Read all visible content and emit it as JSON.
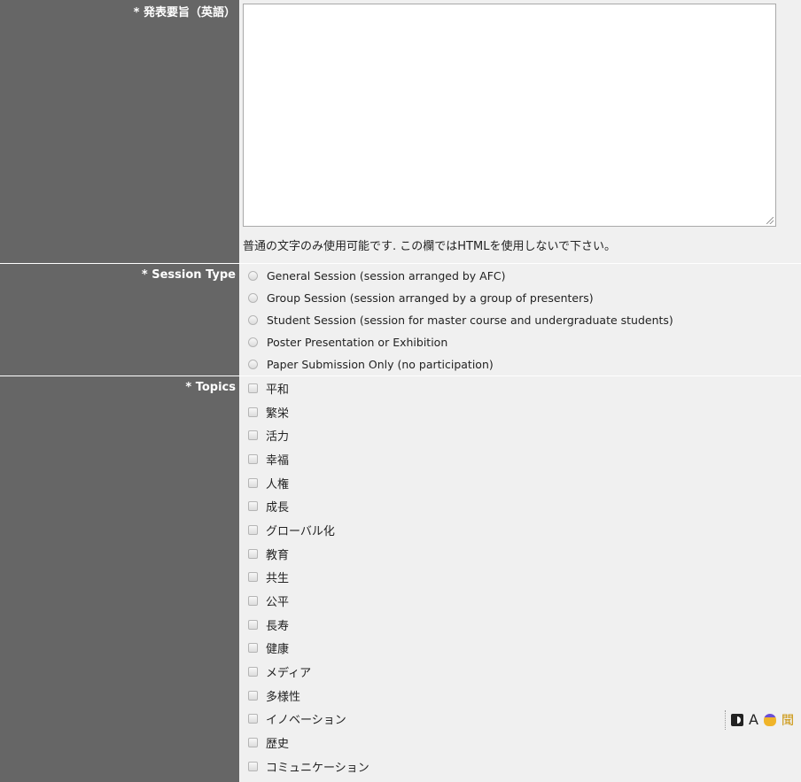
{
  "abstract": {
    "label": "* 発表要旨（英語）",
    "value": "",
    "hint": "普通の文字のみ使用可能です. この欄ではHTMLを使用しないで下さい。"
  },
  "session_type": {
    "label": "* Session Type",
    "options": [
      "General Session (session arranged by AFC)",
      "Group Session (session arranged by a group of presenters)",
      "Student Session (session for master course and undergraduate students)",
      "Poster Presentation or Exhibition",
      "Paper Submission Only (no participation)"
    ]
  },
  "topics": {
    "label": "* Topics",
    "options": [
      "平和",
      "繁栄",
      "活力",
      "幸福",
      "人権",
      "成長",
      "グローバル化",
      "教育",
      "共生",
      "公平",
      "長寿",
      "健康",
      "メディア",
      "多様性",
      "イノベーション",
      "歴史",
      "コミュニケーション"
    ]
  },
  "toolbar": {
    "font_label": "A",
    "more_label": "聞"
  },
  "colors": {
    "label_bg": "#666666",
    "field_bg": "#f0f0f0",
    "label_text": "#ffffff"
  }
}
